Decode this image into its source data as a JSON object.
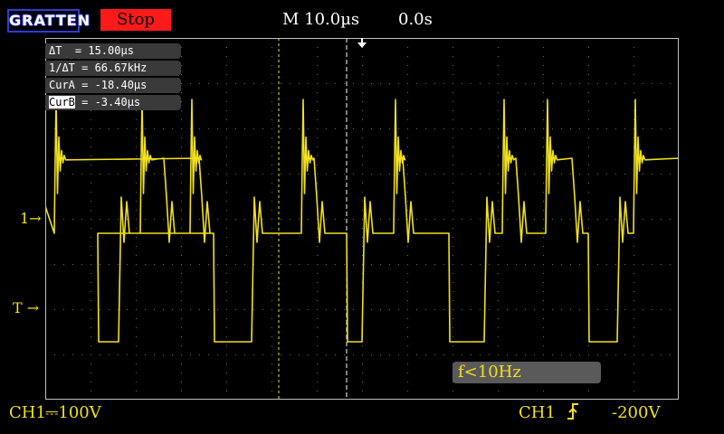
{
  "header": {
    "brand": "GRATTEN",
    "status": "Stop",
    "timebase": "M 10.0µs",
    "delay": "0.0s"
  },
  "cursors": {
    "delta_t": "ΔT  = 15.00µs",
    "inv_delta_t": "1/ΔT = 66.67kHz",
    "cur_a": "CurA = -18.40µs",
    "cur_b_label": "CurB",
    "cur_b_value": " = -3.40µs"
  },
  "markers": {
    "channel": "1→",
    "trigger": "T →"
  },
  "frequency": "f<10Hz",
  "footer": {
    "channel_left": "CH1",
    "coupling": "⎓100V",
    "channel_right": "CH1",
    "edge_icon": "rising-edge-icon",
    "trigger_level": "-200V"
  },
  "colors": {
    "trace": "#f0e020",
    "stop": "#ff1a1a",
    "brand_border": "#2f3bd8",
    "grid_dot": "#6a6a6a"
  }
}
